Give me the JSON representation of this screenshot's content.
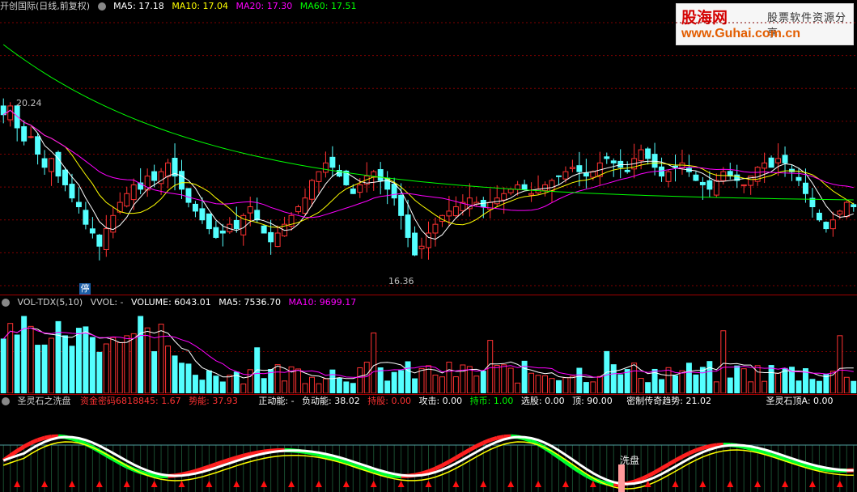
{
  "main_header": {
    "stock_name": "开创国际(日线,前复权)",
    "ma5": "MA5: 17.18",
    "ma10": "MA10: 17.04",
    "ma20": "MA20: 17.30",
    "ma60": "MA60: 17.51"
  },
  "price_annotations": {
    "high": "20.24",
    "low": "16.36",
    "stop_badge": "停"
  },
  "vol_header": {
    "name": "VOL-TDX(5,10)",
    "vvol": "VVOL: -",
    "volume": "VOLUME: 6043.01",
    "ma5": "MA5: 7536.70",
    "ma10": "MA10: 9699.17"
  },
  "ind_header": {
    "name": "圣灵石之洗盘",
    "f1": "资金密码6818845: 1.67",
    "f2": "势能: 37.93",
    "f3": "正动能: -",
    "f4": "负动能: 38.02",
    "f5": "持股: 0.00",
    "f6": "攻击: 0.00",
    "f7": "持币: 1.00",
    "f8": "选股: 0.00",
    "f9": "顶: 90.00",
    "f10": "密制传奇趋势: 21.02",
    "f11": "圣灵石顶A: 0.00"
  },
  "wash_label": "洗盘",
  "logo": {
    "brand": "股海网",
    "slogan": "股票软件资源分享",
    "url": "www.Guhai.com.cn"
  },
  "colors": {
    "up": "#ff3232",
    "down": "#54ffff",
    "ma5": "#ffffff",
    "ma10": "#ffff00",
    "ma20": "#ff00ff",
    "ma60": "#00ff00",
    "grid": "#800000"
  },
  "chart_data": [
    {
      "type": "candlestick",
      "title": "开创国际(日线,前复权)",
      "ylim": [
        16.0,
        22.0
      ],
      "annotations": [
        {
          "label": "20.24",
          "y": 20.24
        },
        {
          "label": "16.36",
          "y": 16.36
        }
      ],
      "series": [
        {
          "name": "MA5",
          "last": 17.18
        },
        {
          "name": "MA10",
          "last": 17.04
        },
        {
          "name": "MA20",
          "last": 17.3
        },
        {
          "name": "MA60",
          "last": 17.51
        }
      ],
      "closes": [
        19.9,
        20.1,
        19.6,
        19.3,
        19.4,
        19.0,
        18.7,
        18.9,
        18.5,
        18.3,
        18.0,
        17.8,
        17.4,
        17.2,
        16.9,
        17.3,
        17.6,
        17.9,
        18.1,
        18.3,
        18.2,
        18.5,
        18.4,
        18.6,
        18.8,
        18.5,
        18.2,
        17.9,
        17.7,
        17.5,
        17.3,
        17.1,
        17.2,
        17.4,
        17.3,
        17.6,
        17.8,
        17.5,
        17.2,
        17.0,
        17.2,
        17.4,
        17.6,
        17.8,
        18.0,
        18.4,
        18.6,
        18.8,
        18.7,
        18.5,
        18.3,
        18.1,
        18.3,
        18.5,
        18.6,
        18.4,
        18.2,
        18.0,
        17.6,
        17.1,
        16.7,
        16.9,
        17.2,
        17.4,
        17.6,
        17.7,
        17.8,
        17.9,
        18.0,
        17.9,
        17.8,
        17.9,
        18.0,
        18.1,
        18.2,
        18.3,
        18.2,
        18.1,
        18.2,
        18.3,
        18.4,
        18.5,
        18.6,
        18.7,
        18.6,
        18.5,
        18.6,
        18.8,
        18.9,
        18.8,
        18.7,
        18.6,
        18.9,
        19.1,
        18.9,
        18.7,
        18.5,
        18.6,
        18.7,
        18.8,
        18.6,
        18.4,
        18.3,
        18.2,
        18.4,
        18.6,
        18.5,
        18.4,
        18.3,
        18.5,
        18.7,
        18.8,
        18.7,
        18.9,
        18.8,
        18.6,
        18.4,
        18.1,
        17.8,
        17.5,
        17.3,
        17.5,
        17.7,
        17.9,
        17.8
      ]
    },
    {
      "type": "bar",
      "title": "VOL-TDX(5,10)",
      "series": [
        {
          "name": "VOLUME",
          "last": 6043.01
        },
        {
          "name": "MA5",
          "last": 7536.7
        },
        {
          "name": "MA10",
          "last": 9699.17
        }
      ]
    },
    {
      "type": "line",
      "title": "圣灵石之洗盘",
      "values": {
        "资金密码6818845": 1.67,
        "势能": 37.93,
        "负动能": 38.02,
        "持股": 0.0,
        "攻击": 0.0,
        "持币": 1.0,
        "选股": 0.0,
        "顶": 90.0,
        "密制传奇趋势": 21.02,
        "圣灵石顶A": 0.0
      }
    }
  ]
}
